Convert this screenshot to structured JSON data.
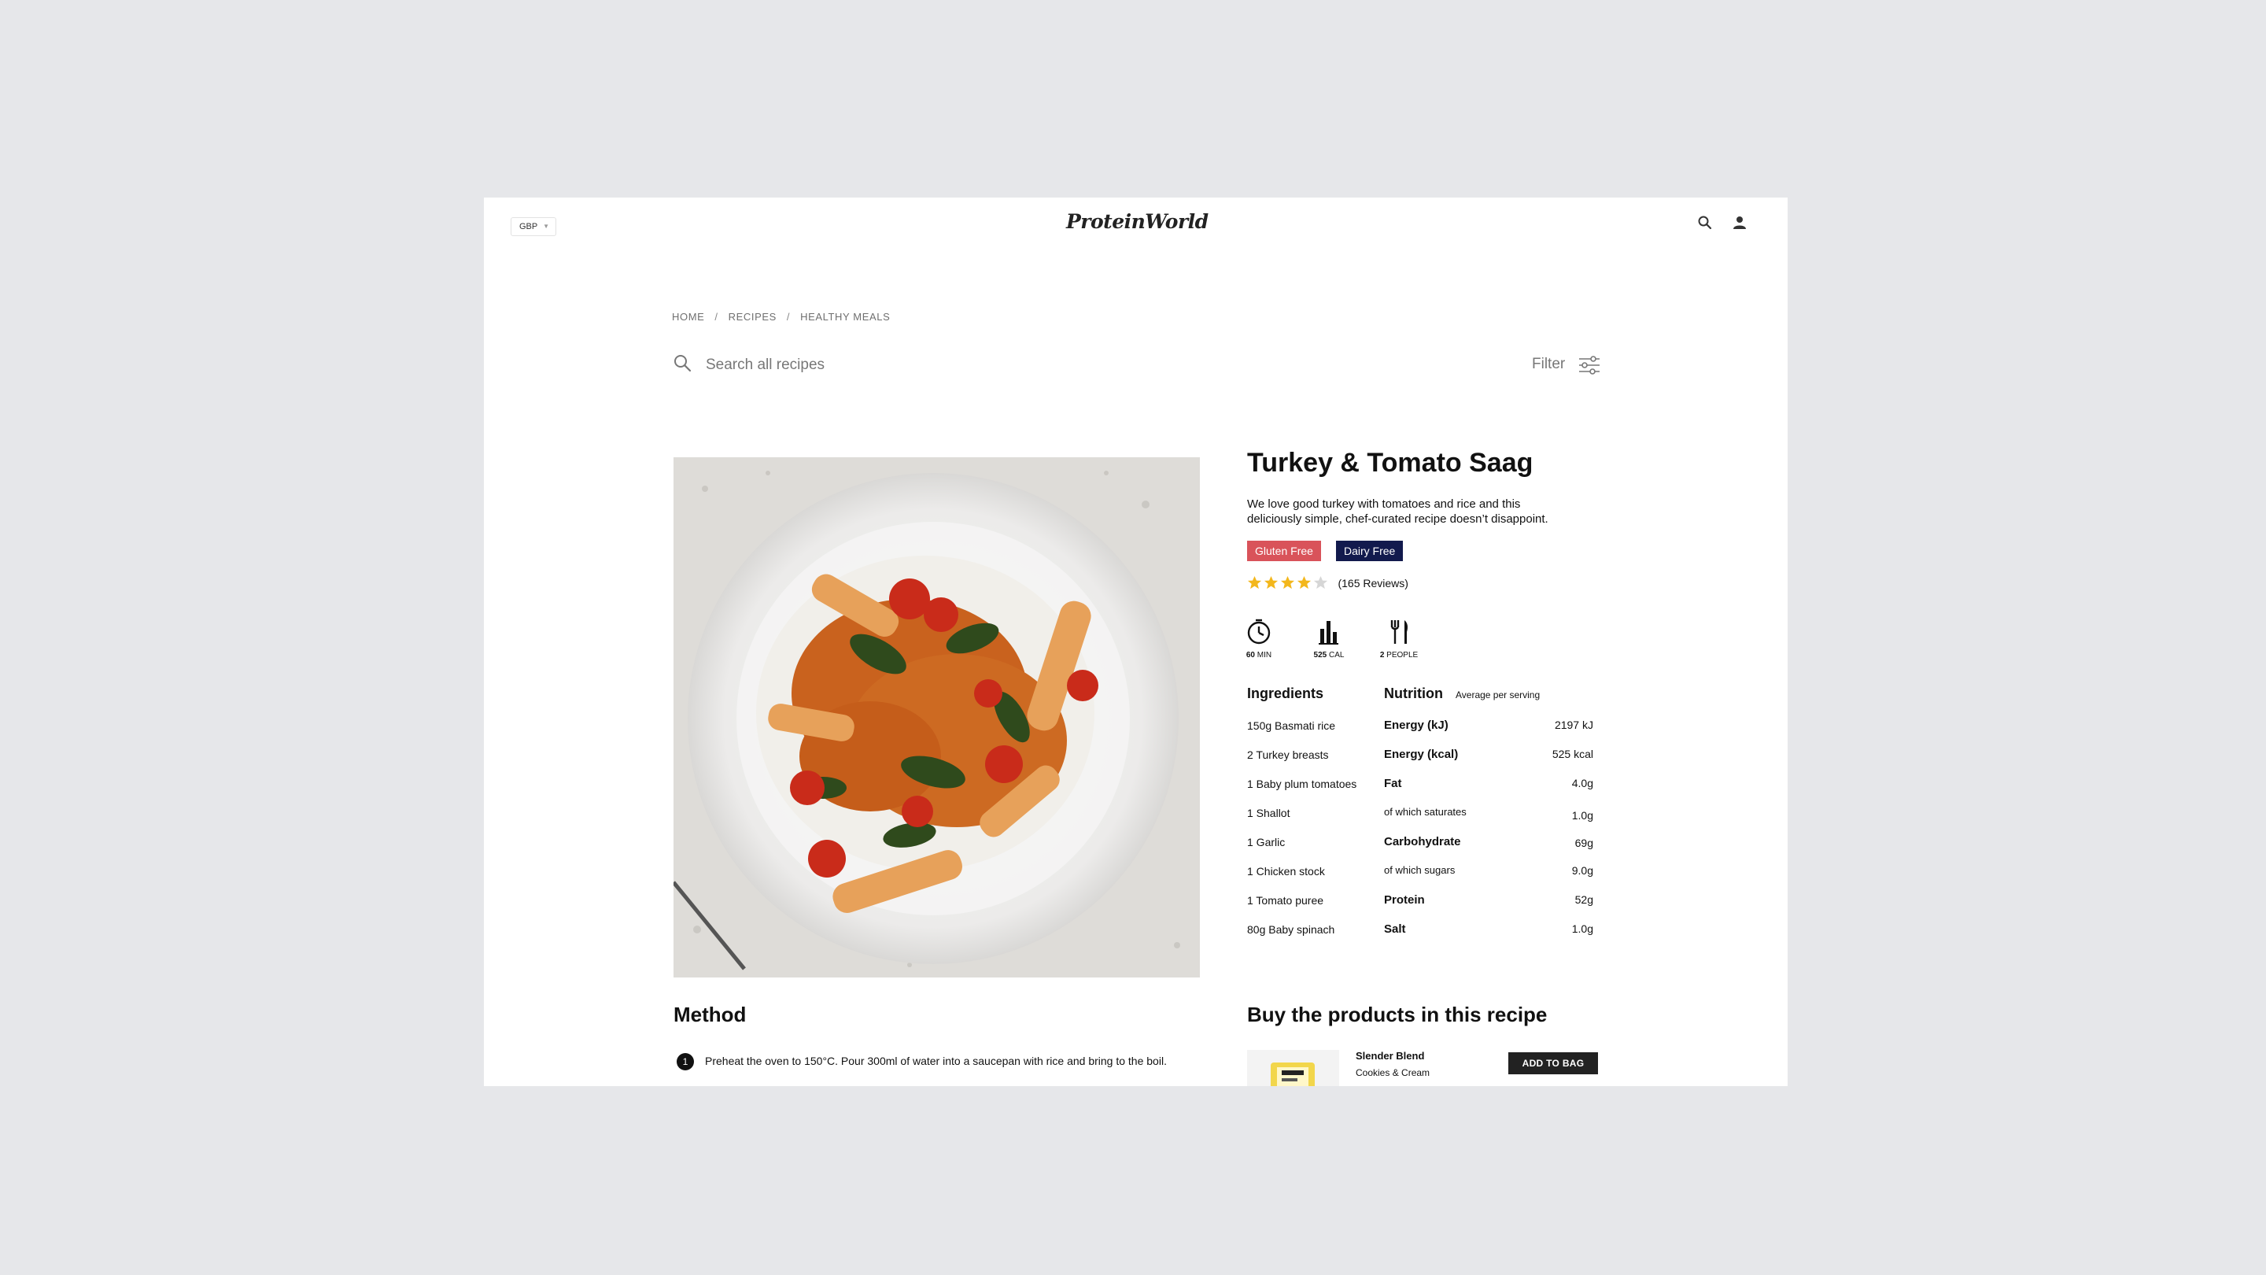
{
  "header": {
    "currency": "GBP",
    "logo_text": "ProteinWorld",
    "search_icon": "search-icon",
    "account_icon": "user-icon"
  },
  "breadcrumb": [
    "HOME",
    "RECIPES",
    "HEALTHY MEALS"
  ],
  "search": {
    "placeholder": "Search all recipes",
    "filter_label": "Filter"
  },
  "recipe": {
    "title": "Turkey & Tomato Saag",
    "description": "We love good turkey with tomatoes and rice and this deliciously simple, chef-curated recipe doesn’t disappoint.",
    "tags": [
      {
        "label": "Gluten Free",
        "color": "#d9535a"
      },
      {
        "label": "Dairy Free",
        "color": "#121a4d"
      }
    ],
    "rating": 4,
    "rating_max": 5,
    "reviews": "(165 Reviews)",
    "stats": [
      {
        "value": "60",
        "unit": "MIN",
        "icon": "clock-icon"
      },
      {
        "value": "525",
        "unit": "CAL",
        "icon": "bar-chart-icon"
      },
      {
        "value": "2",
        "unit": "PEOPLE",
        "icon": "fork-knife-icon"
      }
    ]
  },
  "ingredients": {
    "heading": "Ingredients",
    "items": [
      "150g Basmati rice",
      "2 Turkey breasts",
      "1 Baby plum tomatoes",
      "1 Shallot",
      "1 Garlic",
      "1 Chicken stock",
      "1 Tomato puree",
      "80g Baby spinach"
    ]
  },
  "nutrition": {
    "heading": "Nutrition",
    "subheading": "Average per serving",
    "rows": [
      {
        "name": "Energy (kJ)",
        "value": "2197 kJ",
        "bold": true
      },
      {
        "name": "Energy (kcal)",
        "value": "525 kcal",
        "bold": true
      },
      {
        "name": "Fat",
        "value": "4.0g",
        "bold": true
      },
      {
        "name": "of which saturates",
        "value": "1.0g",
        "bold": false
      },
      {
        "name": "Carbohydrate",
        "value": "69g",
        "bold": true
      },
      {
        "name": "of which sugars",
        "value": "9.0g",
        "bold": false
      },
      {
        "name": "Protein",
        "value": "52g",
        "bold": true
      },
      {
        "name": "Salt",
        "value": "1.0g",
        "bold": true
      }
    ]
  },
  "method": {
    "heading": "Method",
    "steps": [
      {
        "num": "1",
        "text": "Preheat the oven to 150°C. Pour 300ml of water into a saucepan with rice and bring to the boil."
      }
    ]
  },
  "products": {
    "heading": "Buy the products in this recipe",
    "items": [
      {
        "name": "Slender Blend",
        "variant": "Cookies & Cream",
        "button": "ADD TO BAG"
      }
    ]
  }
}
